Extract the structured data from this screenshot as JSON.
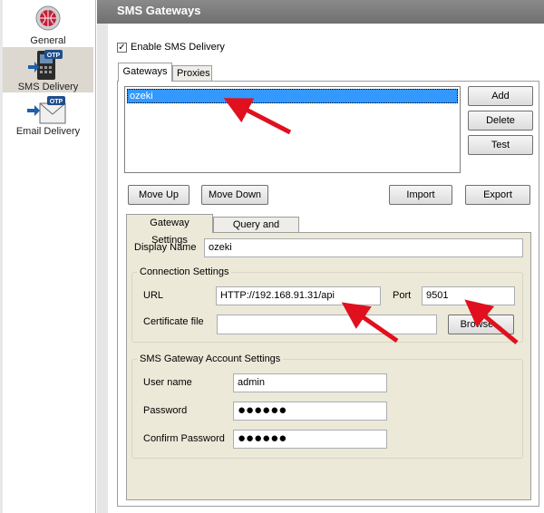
{
  "nav": {
    "items": [
      {
        "label": "General",
        "icon": "general-globe-icon"
      },
      {
        "label": "SMS Delivery",
        "icon": "sms-otp-phone-icon"
      },
      {
        "label": "Email Delivery",
        "icon": "email-otp-envelope-icon"
      }
    ],
    "selected": "SMS Delivery"
  },
  "header": {
    "title": "SMS Gateways"
  },
  "enable": {
    "label": "Enable SMS Delivery",
    "checked": true,
    "mark": "✓"
  },
  "tabs": {
    "gateways": "Gateways",
    "proxies": "Proxies"
  },
  "gateways": {
    "items": [
      "ozeki"
    ],
    "buttons": {
      "add": "Add",
      "delete": "Delete",
      "test": "Test"
    },
    "move_up": "Move Up",
    "move_down": "Move Down",
    "import": "Import",
    "export": "Export"
  },
  "subtabs": {
    "settings": "Gateway Settings",
    "query": "Query and Result"
  },
  "settings": {
    "display_name_label": "Display Name",
    "display_name": "ozeki",
    "connection": {
      "title": "Connection Settings",
      "url_label": "URL",
      "url": "HTTP://192.168.91.31/api",
      "port_label": "Port",
      "port": "9501",
      "cert_label": "Certificate file",
      "cert": "",
      "browse": "Browse..."
    },
    "account": {
      "title": "SMS Gateway Account Settings",
      "user_label": "User name",
      "user": "admin",
      "password_label": "Password",
      "password": "●●●●●●",
      "confirm_label": "Confirm Password",
      "confirm": "●●●●●●"
    }
  },
  "colors": {
    "arrow": "#e0101e",
    "selection": "#3399ff",
    "header": "#7a7a7a",
    "panel": "#ece9d8"
  }
}
